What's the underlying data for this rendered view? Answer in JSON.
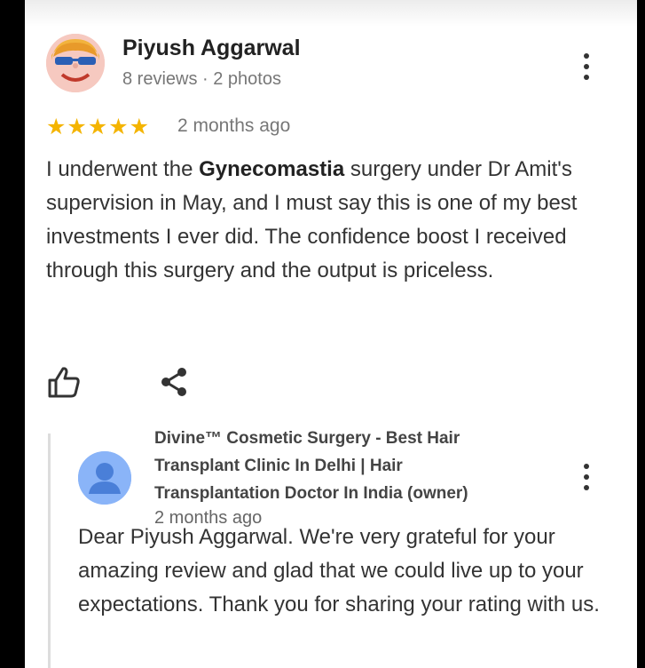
{
  "review": {
    "reviewer_name": "Piyush Aggarwal",
    "reviewer_meta": "8 reviews · 2 photos",
    "rating": 5,
    "stars": "★★★★★",
    "date": "2 months ago",
    "text_before": "I underwent the ",
    "text_bold": "Gynecomastia",
    "text_after": " surgery under Dr Amit's supervision in May, and I must say this is one of my best investments I ever did. The confidence boost I received through this surgery and the output is priceless."
  },
  "reply": {
    "owner_name": "Divine™ Cosmetic Surgery - Best Hair Transplant Clinic In Delhi | Hair Transplantation Doctor In India (owner)",
    "date": "2 months ago",
    "text": "Dear Piyush Aggarwal. We're very grateful for your amazing review and glad that we could live up to your expectations. Thank you for sharing your rating with us."
  },
  "colors": {
    "star": "#f4b400",
    "owner_avatar": "#8ab4f8",
    "text": "#333333"
  },
  "icons": {
    "like": "thumbs-up-icon",
    "share": "share-icon",
    "more": "more-vert-icon"
  }
}
